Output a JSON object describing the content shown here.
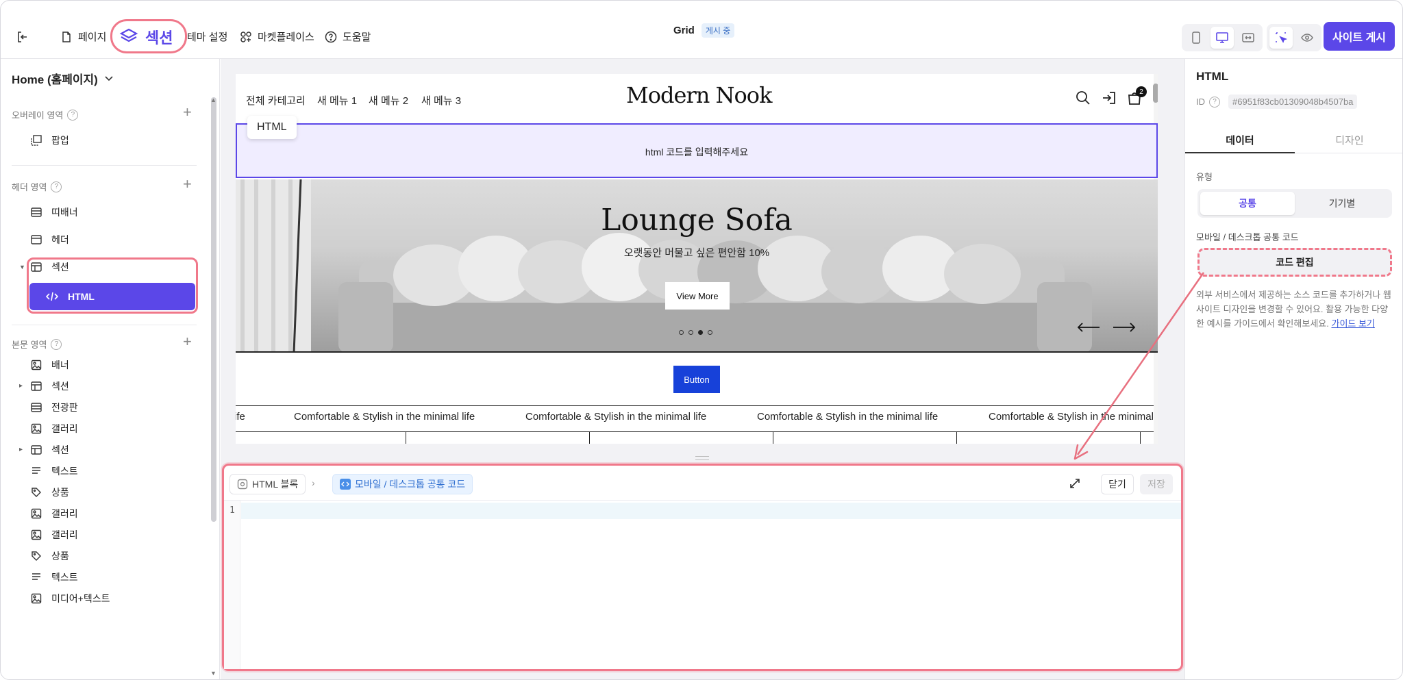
{
  "topbar": {
    "back_icon": "exit-icon",
    "menu": [
      {
        "label": "페이지",
        "icon": "page-icon"
      },
      {
        "label": "섹션",
        "icon": "layers-icon"
      },
      {
        "label": "테마 설정",
        "icon": ""
      },
      {
        "label": "마켓플레이스",
        "icon": "apps-plus-icon"
      },
      {
        "label": "도움말",
        "icon": "help-circle-icon"
      }
    ],
    "site_title": "Grid",
    "status_badge": "게시 중",
    "publish_label": "사이트 게시",
    "accent_color": "#5b47e8"
  },
  "left_panel": {
    "page_select": "Home (홈페이지)",
    "overlay": {
      "label": "오버레이 영역",
      "items": [
        {
          "label": "팝업",
          "icon": "popup-icon"
        }
      ]
    },
    "header": {
      "label": "헤더 영역",
      "items": [
        {
          "label": "띠배너",
          "icon": "banner-strip-icon"
        },
        {
          "label": "헤더",
          "icon": "header-icon"
        },
        {
          "label": "섹션",
          "icon": "section-icon"
        },
        {
          "label": "HTML",
          "icon": "code-icon"
        }
      ]
    },
    "body": {
      "label": "본문 영역",
      "items": [
        {
          "label": "배너",
          "icon": "image-icon"
        },
        {
          "label": "섹션",
          "icon": "section-icon"
        },
        {
          "label": "전광판",
          "icon": "marquee-icon"
        },
        {
          "label": "갤러리",
          "icon": "image-icon"
        },
        {
          "label": "섹션",
          "icon": "section-icon"
        },
        {
          "label": "텍스트",
          "icon": "text-icon"
        },
        {
          "label": "상품",
          "icon": "tag-icon"
        },
        {
          "label": "갤러리",
          "icon": "image-icon"
        },
        {
          "label": "갤러리",
          "icon": "image-icon"
        },
        {
          "label": "상품",
          "icon": "tag-icon"
        },
        {
          "label": "텍스트",
          "icon": "text-icon"
        },
        {
          "label": "미디어+텍스트",
          "icon": "image-icon"
        }
      ]
    }
  },
  "canvas": {
    "nav": [
      "전체 카테고리",
      "새 메뉴 1",
      "새 메뉴 2",
      "새 메뉴 3"
    ],
    "logo": "Modern Nook",
    "cart_count": "2",
    "html_tag": "HTML",
    "html_placeholder": "html 코드를 입력해주세요",
    "hero_title": "Lounge Sofa",
    "hero_subtitle": "오랫동안 머물고 싶은 편안함 10%",
    "hero_button": "View More",
    "button_label": "Button",
    "marquee_first": "ife",
    "marquee_text": "Comfortable & Stylish in the minimal life",
    "marquee_last": "Comfortable & Stylish in the minimal l"
  },
  "editor": {
    "crumb_root": "HTML 블록",
    "crumb_current": "모바일 / 데스크톱 공통 코드",
    "close_label": "닫기",
    "save_label": "저장",
    "line_number": "1"
  },
  "right_panel": {
    "title": "HTML",
    "id_label": "ID",
    "id_value": "#6951f83cb01309048b4507ba",
    "tabs": [
      "데이터",
      "디자인"
    ],
    "type_label": "유형",
    "segments": [
      "공통",
      "기기별"
    ],
    "code_label": "모바일 / 데스크톱 공통 코드",
    "code_button": "코드 편집",
    "help_text": "외부 서비스에서 제공하는 소스 코드를 추가하거나 웹사이트 디자인을 변경할 수 있어요. 활용 가능한 다양한 예시를 가이드에서 확인해보세요.",
    "guide_link": "가이드 보기"
  }
}
